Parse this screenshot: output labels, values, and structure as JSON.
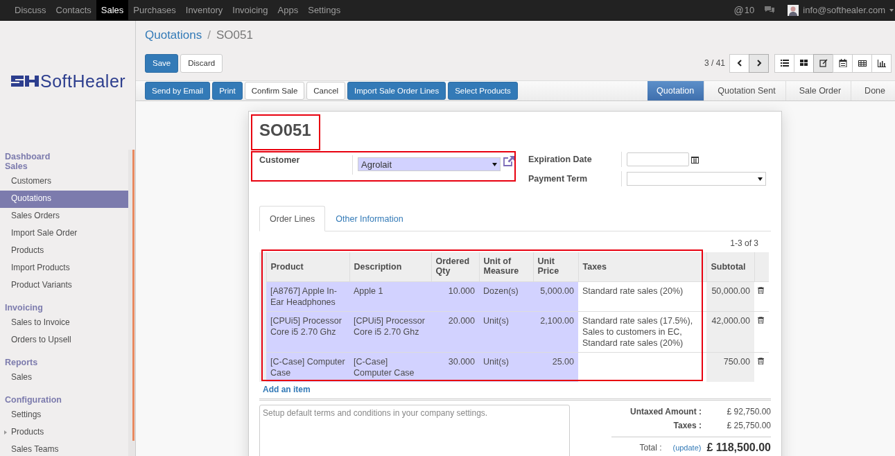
{
  "topbar": {
    "apps": [
      {
        "label": "Discuss",
        "selected": false
      },
      {
        "label": "Contacts",
        "selected": false
      },
      {
        "label": "Sales",
        "selected": true
      },
      {
        "label": "Purchases",
        "selected": false
      },
      {
        "label": "Inventory",
        "selected": false
      },
      {
        "label": "Invoicing",
        "selected": false
      },
      {
        "label": "Apps",
        "selected": false
      },
      {
        "label": "Settings",
        "selected": false
      }
    ],
    "mention_symbol": "@",
    "mentions": "10",
    "user": "info@softhealer.com"
  },
  "sidebar": {
    "logo": "SoftHealer",
    "sections": [
      {
        "title": "Dashboard"
      },
      {
        "title": "Sales",
        "items": [
          {
            "label": "Customers",
            "selected": false,
            "expandable": false
          },
          {
            "label": "Quotations",
            "selected": true,
            "expandable": false
          },
          {
            "label": "Sales Orders",
            "selected": false,
            "expandable": false
          },
          {
            "label": "Import Sale Order",
            "selected": false,
            "expandable": false
          },
          {
            "label": "Products",
            "selected": false,
            "expandable": false
          },
          {
            "label": "Import Products",
            "selected": false,
            "expandable": false
          },
          {
            "label": "Product Variants",
            "selected": false,
            "expandable": false
          }
        ]
      },
      {
        "title": "Invoicing",
        "items": [
          {
            "label": "Sales to Invoice",
            "selected": false,
            "expandable": false
          },
          {
            "label": "Orders to Upsell",
            "selected": false,
            "expandable": false
          }
        ]
      },
      {
        "title": "Reports",
        "items": [
          {
            "label": "Sales",
            "selected": false,
            "expandable": false
          }
        ]
      },
      {
        "title": "Configuration",
        "items": [
          {
            "label": "Settings",
            "selected": false,
            "expandable": false
          },
          {
            "label": "Products",
            "selected": false,
            "expandable": true
          },
          {
            "label": "Sales Teams",
            "selected": false,
            "expandable": false
          }
        ]
      }
    ]
  },
  "breadcrumb": [
    "Quotations",
    "/",
    "SO051"
  ],
  "edit_buttons": [
    {
      "label": "Save",
      "primary": true
    },
    {
      "label": "Discard",
      "primary": false
    }
  ],
  "pager": "3 / 41",
  "views": [
    {
      "kind": "list",
      "selected": false
    },
    {
      "kind": "kanban",
      "selected": false
    },
    {
      "kind": "form",
      "selected": true
    },
    {
      "kind": "calendar",
      "selected": false
    },
    {
      "kind": "pivot",
      "selected": false
    },
    {
      "kind": "graph",
      "selected": false
    }
  ],
  "actions": [
    {
      "label": "Send by Email",
      "primary": true
    },
    {
      "label": "Print",
      "primary": true
    },
    {
      "label": "Confirm Sale",
      "primary": false
    },
    {
      "label": "Cancel",
      "primary": false
    },
    {
      "label": "Import Sale Order Lines",
      "primary": true
    },
    {
      "label": "Select Products",
      "primary": true
    }
  ],
  "stages": [
    {
      "label": "Quotation",
      "selected": true
    },
    {
      "label": "Quotation Sent",
      "selected": false
    },
    {
      "label": "Sale Order",
      "selected": false
    },
    {
      "label": "Done",
      "selected": false
    }
  ],
  "form": {
    "name": "SO051",
    "customer_label": "Customer",
    "customer": "Agrolait",
    "expiration_label": "Expiration Date",
    "payment_term_label": "Payment Term",
    "tabs": [
      {
        "label": "Order Lines",
        "selected": true
      },
      {
        "label": "Other Information",
        "selected": false
      }
    ],
    "lines_pager": "1-3 of 3",
    "columns": [
      "Product",
      "Description",
      "Ordered Qty",
      "Unit of Measure",
      "Unit Price",
      "Taxes",
      "Subtotal"
    ],
    "rows": [
      {
        "product": "[A8767] Apple In-Ear Headphones",
        "description": "Apple 1",
        "qty": "10.000",
        "uom": "Dozen(s)",
        "price": "5,000.00",
        "taxes": [
          "Standard rate sales (20%)"
        ],
        "subtotal": "50,000.00"
      },
      {
        "product": "[CPUi5] Processor Core i5 2.70 Ghz",
        "description": "[CPUi5] Processor Core i5 2.70 Ghz",
        "qty": "20.000",
        "uom": "Unit(s)",
        "price": "2,100.00",
        "taxes": [
          "Standard rate sales (17.5%),",
          "Sales to customers in EC,",
          "Standard rate sales (20%)"
        ],
        "subtotal": "42,000.00"
      },
      {
        "product": "[C-Case] Computer Case",
        "description": "[C-Case] Computer Case",
        "qty": "30.000",
        "uom": "Unit(s)",
        "price": "25.00",
        "taxes": [],
        "subtotal": "750.00"
      }
    ],
    "add_item": "Add an item",
    "terms_placeholder": "Setup default terms and conditions in your company settings.",
    "untaxed_label": "Untaxed Amount :",
    "untaxed": "£ 92,750.00",
    "taxes_label": "Taxes :",
    "taxes": "£ 25,750.00",
    "total_label": "Total :",
    "update": "(update)",
    "total": "£ 118,500.00"
  }
}
